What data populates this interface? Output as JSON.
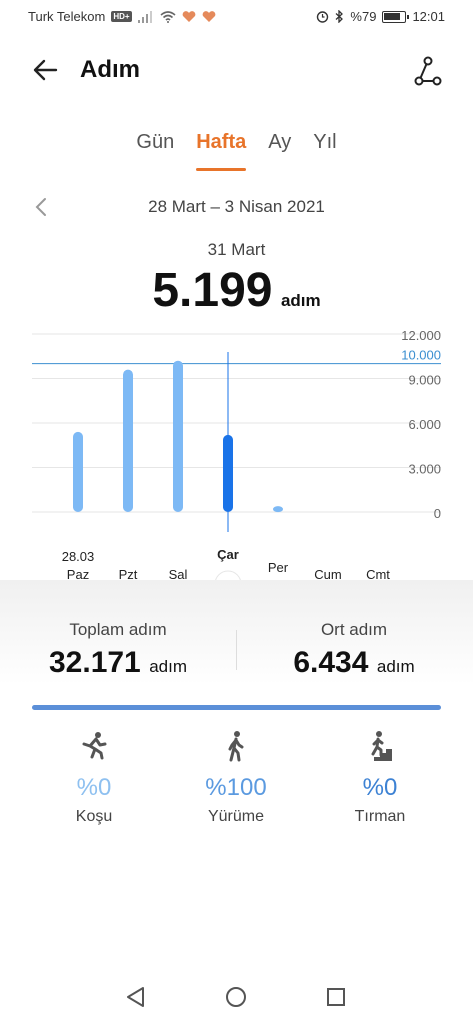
{
  "status_bar": {
    "carrier": "Turk Telekom",
    "hd_badge": "HD+",
    "battery": "%79",
    "time": "12:01"
  },
  "header": {
    "title": "Adım",
    "back_icon": "arrow-left-icon",
    "share_icon": "share-route-icon"
  },
  "tabs": [
    {
      "label": "Gün",
      "active": false
    },
    {
      "label": "Hafta",
      "active": true
    },
    {
      "label": "Ay",
      "active": false
    },
    {
      "label": "Yıl",
      "active": false
    }
  ],
  "range": {
    "label": "28 Mart – 3 Nisan 2021"
  },
  "selected": {
    "day": "31 Mart",
    "steps": "5.199",
    "unit": "adım"
  },
  "colors": {
    "accent": "#e8742a",
    "bar": "#7db9f5",
    "bar_selected": "#1a73e8",
    "goal_line": "#3b8fd0",
    "progress": "#5b8fd8"
  },
  "chart_data": {
    "type": "bar",
    "categories": [
      "Paz",
      "Pzt",
      "Sal",
      "Çar",
      "Per",
      "Cum",
      "Cmt"
    ],
    "first_date_label": "28.03",
    "values": [
      5400,
      9600,
      10200,
      5199,
      400,
      0,
      0
    ],
    "selected_index": 3,
    "ylim": [
      0,
      12000
    ],
    "yticks": [
      "12.000",
      "9.000",
      "6.000",
      "3.000",
      "0"
    ],
    "ytick_values": [
      12000,
      9000,
      6000,
      3000,
      0
    ],
    "goal_value": 10000,
    "goal_label": "10.000"
  },
  "summary": {
    "total_label": "Toplam adım",
    "total_value": "32.171",
    "avg_label": "Ort adım",
    "avg_value": "6.434",
    "unit": "adım",
    "progress": 1.0
  },
  "activities": [
    {
      "icon": "running-icon",
      "pct": "%0",
      "name": "Koşu",
      "color": "#8ec0f0"
    },
    {
      "icon": "walking-icon",
      "pct": "%100",
      "name": "Yürüme",
      "color": "#5b9ae0"
    },
    {
      "icon": "climbing-icon",
      "pct": "%0",
      "name": "Tırman",
      "color": "#3d82d4"
    }
  ]
}
